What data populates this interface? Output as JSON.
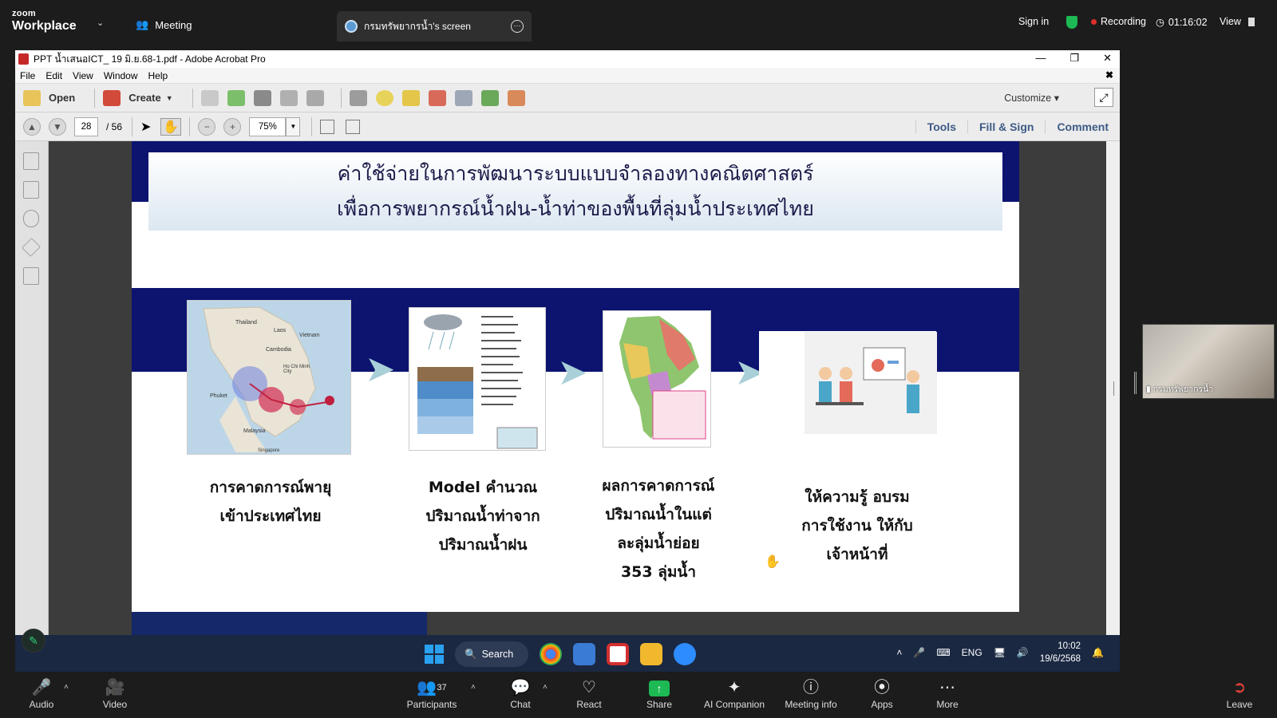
{
  "zoom": {
    "logo_top": "zoom",
    "logo_bottom": "Workplace",
    "meeting_label": "Meeting",
    "screen_tab": "กรมทรัพยากรน้ำ's screen",
    "sign_in": "Sign in",
    "recording": "Recording",
    "timer": "01:16:02",
    "view": "View"
  },
  "acrobat": {
    "window_title": "PPT น้ำเสนอICT_ 19 มิ.ย.68-1.pdf - Adobe Acrobat Pro",
    "menu": [
      "File",
      "Edit",
      "View",
      "Window",
      "Help"
    ],
    "toolbar": {
      "open": "Open",
      "create": "Create",
      "customize": "Customize"
    },
    "nav": {
      "page": "28",
      "total": "/ 56",
      "zoom": "75%"
    },
    "right_links": [
      "Tools",
      "Fill & Sign",
      "Comment"
    ]
  },
  "slide": {
    "title_line1": "ค่าใช้จ่ายในการพัฒนาระบบแบบจำลองทางคณิตศาสตร์",
    "title_line2": "เพื่อการพยากรณ์น้ำฝน-น้ำท่าของพื้นที่ลุ่มน้ำประเทศไทย",
    "captions": [
      [
        "การคาดการณ์พายุ",
        "เข้าประเทศไทย"
      ],
      [
        "Model คำนวณ",
        "ปริมาณน้ำท่าจาก",
        "ปริมาณน้ำฝน"
      ],
      [
        "ผลการคาดการณ์",
        "ปริมาณน้ำในแต่",
        "ละลุ่มน้ำย่อย",
        "353 ลุ่มน้ำ"
      ],
      [
        "ให้ความรู้ อบรม",
        "การใช้งาน ให้กับ",
        "เจ้าหน้าที่"
      ]
    ],
    "map_labels": [
      "Thailand",
      "Laos",
      "Vietnam",
      "Cambodia",
      "Ho Chi Minh City",
      "Phuket",
      "Malaysia",
      "Singapore"
    ]
  },
  "participant_tile": {
    "name": "กรมทรัพยากรน้ำ"
  },
  "taskbar": {
    "search": "Search",
    "lang": "ENG",
    "time": "10:02",
    "date": "19/6/2568"
  },
  "controls": {
    "audio": "Audio",
    "video": "Video",
    "participants": "Participants",
    "participants_count": "37",
    "chat": "Chat",
    "react": "React",
    "share": "Share",
    "ai": "AI Companion",
    "info": "Meeting info",
    "apps": "Apps",
    "more": "More",
    "leave": "Leave"
  },
  "colors": {
    "slide_navy": "#0c1470",
    "share_green": "#1db954",
    "record_red": "#e02f2f",
    "acro_link": "#3d5a86"
  }
}
